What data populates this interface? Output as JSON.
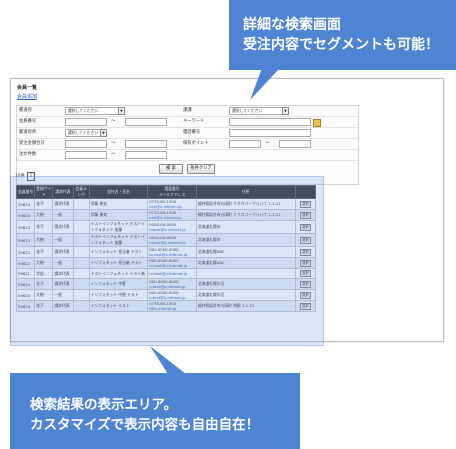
{
  "page": {
    "title": "会員一覧",
    "link": "会員追加"
  },
  "search": {
    "rows": [
      {
        "label": "都道府",
        "select_text": "選択してください",
        "label2": "課課",
        "select2_text": "選択してください"
      },
      {
        "label": "会員番号",
        "tilde": "〜",
        "label2": "キーワード"
      },
      {
        "label": "都道府県",
        "select_text": "選択してください",
        "label2": "電話番号"
      },
      {
        "label": "受注金額合計",
        "tilde": "〜",
        "label2": "保有ポイント",
        "tilde2": "〜"
      },
      {
        "label": "注文件数",
        "tilde": "〜"
      }
    ],
    "search_button": "検 索",
    "clear_button": "条件クリア"
  },
  "results": {
    "count_label": "10件",
    "page": "1",
    "columns": [
      "会員番号",
      "登録サイト",
      "請求代表",
      "会員ランク",
      "会社名・氏名",
      "電話番号\nメールアドレス",
      "住所",
      ""
    ],
    "rows": [
      {
        "id": "59624",
        "site": "花子",
        "rep": "請求代表",
        "rank": "",
        "name": "伊藤 勇気",
        "tel": "0770-60-1300",
        "mail": "kirii@x-infonet.jp",
        "address": "福井県坂井市丸岡町 リクオバークらいて 1-1-21",
        "action": "選択"
      },
      {
        "id": "59624",
        "site": "大樹",
        "rep": "一般",
        "rank": "",
        "name": "伊藤 勇気",
        "tel": "0770-60-1300",
        "mail": "kirii@x-infonet.jp",
        "address": "福井県坂井市丸岡町 リクオバークらいて 1-1-21",
        "action": "選択"
      },
      {
        "id": "59623",
        "site": "花子",
        "rep": "請求代表",
        "rank": "",
        "name": "テストインフォネット テストインフォネット 加藤",
        "tel": "0000-00-0000",
        "mail": "mbari@x-infonet.jp",
        "address": "北海道札幌市",
        "action": "選択"
      },
      {
        "id": "59623",
        "site": "大樹",
        "rep": "一般",
        "rank": "",
        "name": "テストインフォネット テストインフォネット 加藤",
        "tel": "0000-00-0000",
        "mail": "mbari@x-infonet.jp",
        "address": "北海道札幌市",
        "action": "選択"
      },
      {
        "id": "59622",
        "site": "花子",
        "rep": "請求代表",
        "rank": "",
        "name": "インフォネット 担当者 テスト",
        "tel": "000-0000-0000",
        "mail": "tx-test@x-infonet.jp",
        "address": "北海道札幌ABC",
        "action": "選択"
      },
      {
        "id": "59622",
        "site": "大樹",
        "rep": "一般",
        "rank": "",
        "name": "インフォネット 担当者 テスト",
        "tel": "000-0000-0000",
        "mail": "tx-test@x-infonet.jp",
        "address": "北海道札幌ABC",
        "action": "選択"
      },
      {
        "id": "59621",
        "site": "学部",
        "rep": "請求代表",
        "rank": "",
        "name": "テストインフォネット テスト為",
        "tel": "",
        "mail": "tx-test@x-infonet.jp",
        "address": "",
        "action": "選択"
      },
      {
        "id": "59620",
        "site": "花子",
        "rep": "請求代表",
        "rank": "",
        "name": "インフォネット 中堅",
        "tel": "000-0000-0000",
        "mail": "y-test@x-infonet.jp",
        "address": "北海道札幌の辺",
        "action": "選択"
      },
      {
        "id": "59620",
        "site": "大樹",
        "rep": "一般",
        "rank": "",
        "name": "インフォネット 中堅 テスト",
        "tel": "000-0000-0000",
        "mail": "y-test@x-infonet.jp",
        "address": "北海道札幌の辺",
        "action": "選択"
      },
      {
        "id": "59619",
        "site": "花子",
        "rep": "請求代表",
        "rank": "",
        "name": "インフォネット テスト",
        "tel": "0770-60-1300",
        "mail": "t@x-infonet.jp",
        "address": "福井県坂井市丸岡町 辨屋 1-1-21",
        "action": "選択"
      }
    ]
  },
  "callouts": {
    "top": [
      "詳細な検索画面",
      "受注内容でセグメントも可能！"
    ],
    "bottom": [
      "検索結果の表示エリア。",
      "カスタマイズで表示内容も自由自在！"
    ]
  },
  "colors": {
    "callout": "#4f84d3",
    "overlay": "rgba(90,140,220,0.22)",
    "header": "#3a3a3a",
    "link": "#2a5db0"
  }
}
